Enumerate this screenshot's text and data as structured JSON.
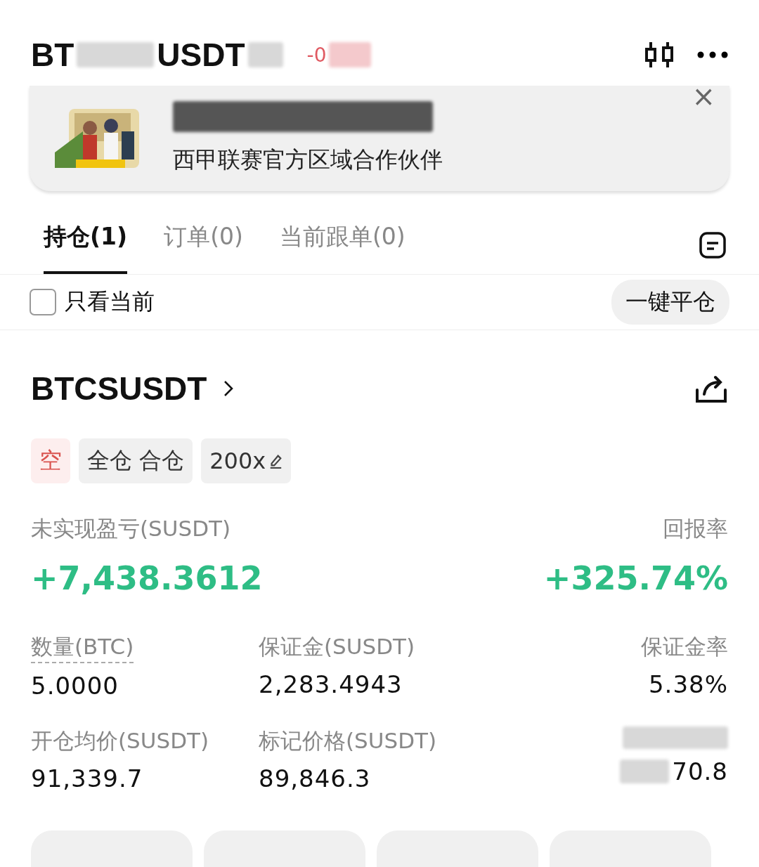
{
  "header": {
    "title_start": "BT",
    "title_end": "USDT",
    "change": "-0"
  },
  "banner": {
    "subtitle": "西甲联赛官方区域合作伙伴",
    "close": "×"
  },
  "tabs": [
    {
      "label": "持仓(1)",
      "selected": true
    },
    {
      "label": "订单(0)",
      "selected": false
    },
    {
      "label": "当前跟单(0)",
      "selected": false
    }
  ],
  "filter": {
    "label": "只看当前",
    "checked": false,
    "close_all": "一键平仓"
  },
  "position": {
    "symbol": "BTCSUSDT",
    "tags": [
      {
        "kind": "side",
        "label": "空"
      },
      {
        "kind": "mode",
        "label": "全仓 合仓"
      },
      {
        "kind": "leverage",
        "label": "200x"
      }
    ],
    "pnl_label": "未实现盈亏(SUSDT)",
    "pnl": "+7,438.3612",
    "roe_label": "回报率",
    "roe": "+325.74%",
    "stats": [
      {
        "label": "数量(BTC)",
        "value": "5.0000",
        "dashed": true
      },
      {
        "label": "保证金(SUSDT)",
        "value": "2,283.4943",
        "dashed": false
      },
      {
        "label": "保证金率",
        "value": "5.38%",
        "dashed": false
      },
      {
        "label": "开仓均价(SUSDT)",
        "value": "91,339.7",
        "dashed": false
      },
      {
        "label": "标记价格(SUSDT)",
        "value": "89,846.3",
        "dashed": false
      },
      {
        "kind": "masked",
        "value": "70.8",
        "dashed": false
      }
    ]
  }
}
